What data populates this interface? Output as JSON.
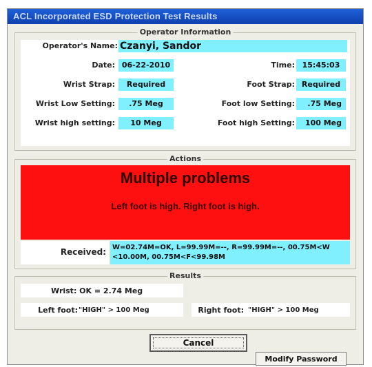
{
  "window": {
    "title": "ACL Incorporated ESD Protection Test Results"
  },
  "operator": {
    "group_label": "Operator Information",
    "name_label": "Operator's Name:",
    "name_value": "Czanyi, Sandor",
    "date_label": "Date:",
    "date_value": "06-22-2010",
    "time_label": "Time:",
    "time_value": "15:45:03",
    "wrist_strap_label": "Wrist Strap:",
    "wrist_strap_value": "Required",
    "foot_strap_label": "Foot Strap:",
    "foot_strap_value": "Required",
    "wrist_low_label": "Wrist Low Setting:",
    "wrist_low_value": ".75 Meg",
    "foot_low_label": "Foot low Setting:",
    "foot_low_value": ".75 Meg",
    "wrist_high_label": "Wrist high setting:",
    "wrist_high_value": "10 Meg",
    "foot_high_label": "Foot high Setting:",
    "foot_high_value": "100 Meg"
  },
  "actions": {
    "group_label": "Actions",
    "headline": "Multiple problems",
    "detail": "Left foot is high. Right foot is high.",
    "received_label": "Received:",
    "received_line1": "W=02.74M=OK, L=99.99M=--, R=99.99M=--, 00.75M<W",
    "received_line2": "<10.00M, 00.75M<F<99.98M"
  },
  "results": {
    "group_label": "Results",
    "wrist_text": "Wrist: OK   = 2.74 Meg",
    "left_foot_label": "Left foot:",
    "left_foot_value": "\"HIGH\" > 100 Meg",
    "right_foot_label": "Right foot:",
    "right_foot_value": "\"HIGH\" > 100 Meg"
  },
  "buttons": {
    "cancel": "Cancel",
    "modify_password": "Modify Password"
  },
  "colors": {
    "alert": "#ff1010",
    "field": "#80f0ff",
    "title_bar": "#1f61d8"
  }
}
